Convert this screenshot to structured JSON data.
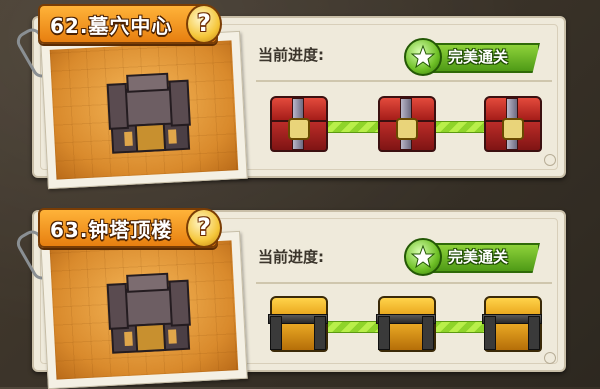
{
  "levels": [
    {
      "title": "62.墓穴中心",
      "help_icon": "?",
      "progress_label": "当前进度:",
      "status_label": "完美通关",
      "chest_style": "red",
      "chests": 3
    },
    {
      "title": "63.钟塔顶楼",
      "help_icon": "?",
      "progress_label": "当前进度:",
      "status_label": "完美通关",
      "chest_style": "gold",
      "chests": 3
    }
  ],
  "colors": {
    "title_tab": "#f0900f",
    "progress_track": "#a6e33a",
    "badge": "#6ab82a"
  }
}
